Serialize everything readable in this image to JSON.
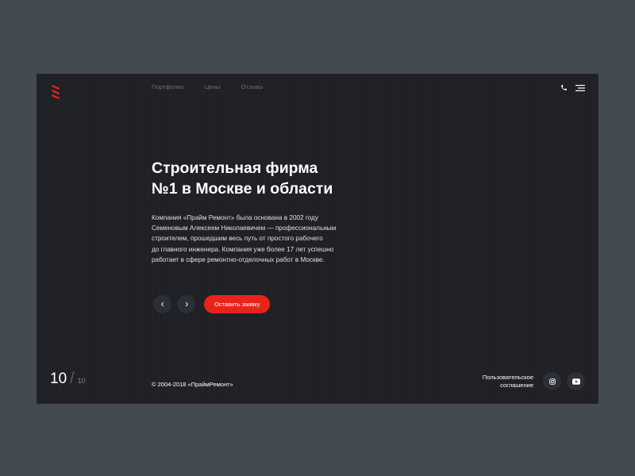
{
  "nav": {
    "items": [
      {
        "label": "Портфолио"
      },
      {
        "label": "Цены"
      },
      {
        "label": "Отзывы"
      }
    ]
  },
  "hero": {
    "title_lines": [
      "Строительная фирма",
      "№1 в Москве и области"
    ],
    "description_lines": [
      "Компания «Прайм Ремонт» была основана в 2002 году",
      "Семеновым Алексеем Николаевичем — профессиональным",
      "строителем, прошедшим весь путь от простого рабочего",
      "до главного инженера. Компания уже более 17 лет успешно",
      "работает в сфере ремонтно-отделочных работ в Москве."
    ],
    "cta_label": "Оставить заявку"
  },
  "slider": {
    "current": "10",
    "separator": "/",
    "total": "10"
  },
  "footer": {
    "copyright": "© 2004-2018 «ПраймРемонт»",
    "agreement_lines": [
      "Пользовательское",
      "соглашение"
    ]
  },
  "colors": {
    "page_bg": "#444a52",
    "panel_bg": "#1f2126",
    "accent": "#e8231a",
    "muted_text": "#6c7078"
  },
  "icons": {
    "logo": "stripes-logo-icon",
    "phone": "phone-icon",
    "menu": "hamburger-menu-icon",
    "prev": "chevron-left-icon",
    "next": "chevron-right-icon",
    "instagram": "instagram-icon",
    "youtube": "youtube-icon"
  }
}
